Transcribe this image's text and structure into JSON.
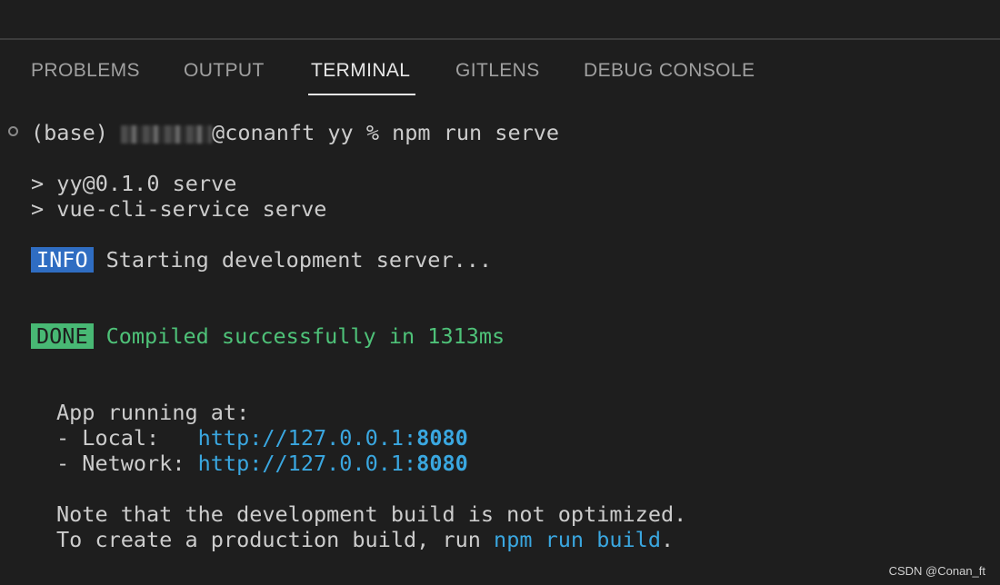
{
  "panel": {
    "tabs": [
      {
        "label": "PROBLEMS"
      },
      {
        "label": "OUTPUT"
      },
      {
        "label": "TERMINAL",
        "active": true
      },
      {
        "label": "GITLENS"
      },
      {
        "label": "DEBUG CONSOLE"
      }
    ]
  },
  "terminal": {
    "prompt": {
      "prefix": "(base)",
      "user_redacted": "",
      "host": "@conanft yy % ",
      "command": "npm run serve"
    },
    "script_lines": [
      "> yy@0.1.0 serve",
      "> vue-cli-service serve"
    ],
    "info": {
      "badge": "INFO",
      "text": "Starting development server..."
    },
    "done": {
      "badge": "DONE",
      "text": "Compiled successfully in 1313ms"
    },
    "app_running": {
      "heading": "App running at:",
      "local_label": "- Local:   ",
      "local_url": "http://127.0.0.1:",
      "local_port": "8080",
      "network_label": "- Network: ",
      "network_url": "http://127.0.0.1:",
      "network_port": "8080"
    },
    "note": {
      "line1": "Note that the development build is not optimized.",
      "line2_prefix": "To create a production build, run ",
      "line2_cmd": "npm run build",
      "line2_suffix": "."
    }
  },
  "watermark": "CSDN @Conan_ft",
  "colors": {
    "background": "#1e1e1e",
    "info_badge": "#2f6dc2",
    "done_badge": "#48b874",
    "link": "#3aa7e0",
    "success_text": "#4ec178"
  }
}
